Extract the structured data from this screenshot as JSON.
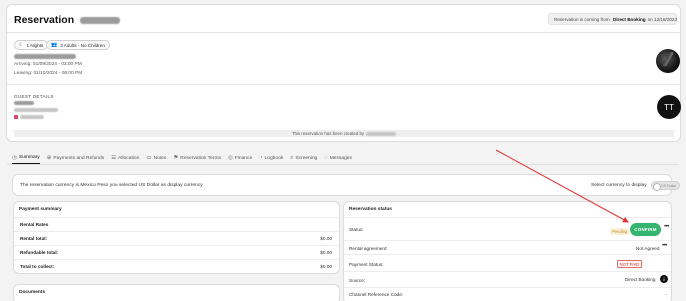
{
  "header": {
    "title": "Reservation",
    "source_prefix": "Reservation is coming from",
    "source_name": "Direct Booking",
    "source_on": "on",
    "source_date": "12/18/2023"
  },
  "badges": [
    {
      "icon": "moon-icon",
      "glyph": "☾",
      "label": "1 Nights"
    },
    {
      "icon": "people-icon",
      "glyph": "👥",
      "label": "3 Adults - No Children"
    }
  ],
  "stay": {
    "arriving": "Arriving: 01/09/2024 - 03:00 PM",
    "leaving": "Leaving: 01/10/2024 - 08:00 PM"
  },
  "guest": {
    "label": "GUEST DETAILS",
    "initials": "TT"
  },
  "created_note": "This reservation has been created by",
  "tabs": [
    {
      "name": "tab-summary",
      "icon": "summary-icon",
      "glyph": "◷",
      "label": "Summary",
      "active": true
    },
    {
      "name": "tab-payments-and-refunds",
      "icon": "payments-icon",
      "glyph": "⊕",
      "label": "Payments and Refunds"
    },
    {
      "name": "tab-allocation",
      "icon": "allocation-icon",
      "glyph": "☰",
      "label": "Allocation"
    },
    {
      "name": "tab-notes",
      "icon": "notes-icon",
      "glyph": "▭",
      "label": "Notes"
    },
    {
      "name": "tab-reservation-terms",
      "icon": "bookmark-icon",
      "glyph": "⚑",
      "label": "Reservation Terms"
    },
    {
      "name": "tab-finance",
      "icon": "finance-icon",
      "glyph": "◎",
      "label": "Finance"
    },
    {
      "name": "tab-logbook",
      "icon": "logbook-icon",
      "glyph": "◔",
      "label": "Logbook"
    },
    {
      "name": "tab-screening",
      "icon": "search-icon",
      "glyph": "⌕",
      "label": "Screening"
    },
    {
      "name": "tab-messages",
      "icon": "message-icon",
      "glyph": "◌",
      "label": "Messages"
    }
  ],
  "currency": {
    "text": "The reservation currency is Mexico Peso you selected US Dollar as display currency",
    "select_label": "Select currency to display",
    "toggle_text": "US Dollar"
  },
  "payment_summary": {
    "title": "Payment summary",
    "rental_rates_label": "Rental Rates",
    "rows": [
      {
        "label": "Rental total:",
        "value": "$0.00"
      },
      {
        "label": "Refundable total:",
        "value": "$0.00"
      },
      {
        "label": "Total to collect:",
        "value": "$0.00"
      }
    ]
  },
  "documents": {
    "title": "Documents"
  },
  "reservation_status": {
    "title": "Reservation status",
    "status_label": "Status:",
    "status_value": "Pending",
    "confirm_label": "CONFIRM",
    "rental_agreement_label": "Rental agreement:",
    "rental_agreement_value": "Not Agreed",
    "payment_status_label": "Payment Status:",
    "payment_status_value": "NOT PAID",
    "source_label": "Source:",
    "source_value": "Direct Booking",
    "channel_ref_label": "Channel Reference Code:",
    "channel_ref_value": "-"
  },
  "colors": {
    "confirm": "#35b56f",
    "pending": "#c28d1b",
    "not_paid": "#d23c3c",
    "arrow": "#e03030"
  }
}
